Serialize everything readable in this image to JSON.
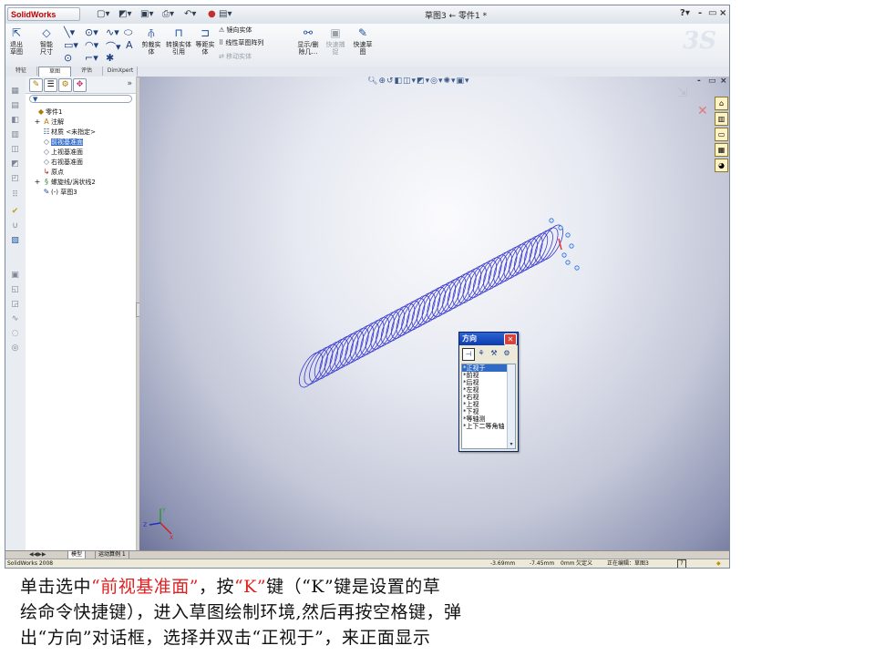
{
  "app": {
    "logo_text": "SolidWorks",
    "doc_title": "草图3 ← 零件1 *",
    "help": "?",
    "win_controls": [
      "-",
      "▭",
      "×"
    ]
  },
  "toolbar": {
    "exit_sketch": "退出草图",
    "smart_dim": "智能尺寸",
    "trim": "剪裁实体",
    "convert": "转换实体引用",
    "offset": "等距实体",
    "mirror": "镜向实体",
    "linear_pattern": "线性草图阵列",
    "move": "移动实体",
    "display_delete": "显示/删除几…",
    "quick_snap": "快速捕捉",
    "rapid_sketch": "快速草图"
  },
  "tabs": [
    "特征",
    "草图",
    "评估",
    "DimXpert"
  ],
  "panel": {
    "filter_icon": "filter-icon",
    "tree": [
      {
        "label": "零件1",
        "icon": "part-icon",
        "indent": 0,
        "expand": ""
      },
      {
        "label": "注解",
        "icon": "annotation-icon",
        "indent": 1,
        "expand": "+"
      },
      {
        "label": "材质 <未指定>",
        "icon": "material-icon",
        "indent": 1,
        "expand": ""
      },
      {
        "label": "前视基准面",
        "icon": "plane-icon",
        "indent": 1,
        "expand": "",
        "selected": true
      },
      {
        "label": "上视基准面",
        "icon": "plane-icon",
        "indent": 1,
        "expand": ""
      },
      {
        "label": "右视基准面",
        "icon": "plane-icon",
        "indent": 1,
        "expand": ""
      },
      {
        "label": "原点",
        "icon": "origin-icon",
        "indent": 1,
        "expand": ""
      },
      {
        "label": "螺旋线/涡状线2",
        "icon": "helix-icon",
        "indent": 1,
        "expand": "+"
      },
      {
        "label": "(-) 草图3",
        "icon": "sketch-icon",
        "indent": 1,
        "expand": ""
      }
    ]
  },
  "orientation_dialog": {
    "title": "方向",
    "items": [
      "*正视于",
      "*前视",
      "*后视",
      "*左视",
      "*右视",
      "*上视",
      "*下视",
      "*等轴测",
      "*上下二等角轴"
    ],
    "selected_index": 0
  },
  "bottom_tabs": [
    "模型",
    "运动算例 1"
  ],
  "status": {
    "app": "SolidWorks 2008",
    "x": "-3.69mm",
    "y": "-7.45mm",
    "z": "0mm",
    "state": "欠定义",
    "editing": "正在编辑：草图3"
  },
  "caption": {
    "l1a": "单击选中",
    "l1b": "“前视基准面”",
    "l1c": "，按",
    "l1d": "“K”",
    "l1e": "键（“K”键是设置的草",
    "line2": "绘命令快捷键），进入草图绘制环境,然后再按空格键，弹",
    "line3": "出“方向”对话框，选择并双击“正视于”，来正面显示"
  },
  "colors": {
    "helix": "#3a3ad0",
    "selection": "#316ac5",
    "caption_red": "#e02020"
  }
}
